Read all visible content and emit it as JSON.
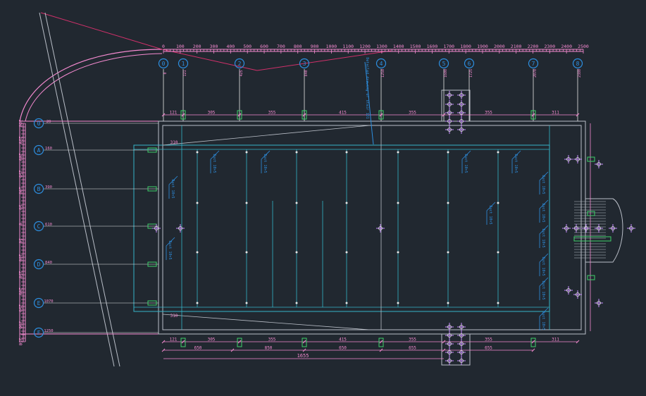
{
  "colors": {
    "background": "#212830",
    "magenta": "#ff6fd8",
    "pink": "#f58ad0",
    "cyan": "#35b5c9",
    "blue": "#2d8fe0",
    "green": "#3fd06a",
    "white": "#e6e6e6",
    "grey": "#b9bec7",
    "violet": "#c88cff",
    "red": "#d0306a"
  },
  "ruler_top": {
    "labels": [
      "0",
      "100",
      "200",
      "300",
      "400",
      "500",
      "600",
      "700",
      "800",
      "900",
      "1000",
      "1100",
      "1200",
      "1300",
      "1400",
      "1500",
      "1600",
      "1700",
      "1800",
      "1900",
      "2000",
      "2100",
      "2200",
      "2300",
      "2400",
      "2500"
    ]
  },
  "ruler_left": {
    "labels": [
      "300",
      "250",
      "200",
      "150",
      "100",
      "50",
      "0",
      "50",
      "100",
      "150",
      "200",
      "250",
      "300",
      "350"
    ]
  },
  "grid_top": [
    {
      "label": "0",
      "sub": "0"
    },
    {
      "label": "1",
      "sub": "121"
    },
    {
      "label": "2",
      "sub": "425"
    },
    {
      "label": "3",
      "sub": "840"
    },
    {
      "label": "4",
      "sub": "1250"
    },
    {
      "label": "5",
      "sub": "1600"
    },
    {
      "label": "6",
      "sub": "1725"
    },
    {
      "label": "7",
      "sub": "2070"
    },
    {
      "label": "8",
      "sub": "2380"
    }
  ],
  "grid_left": [
    {
      "label": "0",
      "sub": "20"
    },
    {
      "label": "A",
      "sub": "160"
    },
    {
      "label": "B",
      "sub": "390"
    },
    {
      "label": "C",
      "sub": "610"
    },
    {
      "label": "D",
      "sub": "840"
    },
    {
      "label": "E",
      "sub": "1070"
    },
    {
      "label": "F",
      "sub": "1250"
    }
  ],
  "dims": {
    "top": [
      "121",
      "305",
      "355",
      "415",
      "355",
      "355",
      "311"
    ],
    "left": [
      "310",
      "310"
    ],
    "bottom1": [
      "121",
      "305",
      "355",
      "415",
      "355",
      "355",
      "311"
    ],
    "bottom2": [
      "650",
      "850",
      "650",
      "655",
      "655"
    ],
    "overall": "1655"
  },
  "notes": {
    "diagonal": "Detailed drawing of stair 1D1",
    "pipe": "Duct 10×5",
    "pipe_v": "Duct 8×5"
  }
}
